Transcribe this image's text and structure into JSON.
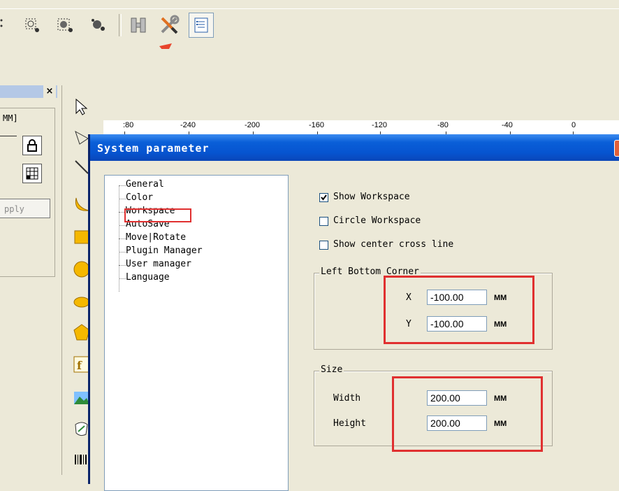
{
  "left_panel": {
    "unit_label": "MM]",
    "apply_label": "pply",
    "close_glyph": "×"
  },
  "ruler": {
    "ticks": [
      ":80",
      "-240",
      "-200",
      "-160",
      "-120",
      "-80",
      "-40",
      "0"
    ]
  },
  "dialog": {
    "title": "System parameter",
    "tree_items": [
      "General",
      "Color",
      "Workspace",
      "AutoSave",
      "Move|Rotate",
      "Plugin Manager",
      "User manager",
      "Language"
    ],
    "show_workspace": {
      "label": "Show Workspace",
      "checked": true
    },
    "circle_workspace": {
      "label": "Circle Workspace",
      "checked": false
    },
    "show_center_cross": {
      "label": "Show center cross line",
      "checked": false
    },
    "left_bottom_corner": {
      "title": "Left Bottom Corner",
      "x_label": "X",
      "x_value": "-100.00",
      "y_label": "Y",
      "y_value": "-100.00",
      "unit": "MM"
    },
    "size": {
      "title": "Size",
      "width_label": "Width",
      "width_value": "200.00",
      "height_label": "Height",
      "height_value": "200.00",
      "unit": "MM"
    }
  },
  "colors": {
    "highlight": "#e03030",
    "titlebar": "#0654d0",
    "arrow": "#e8452c"
  },
  "icons": [
    "select-points-icon",
    "nodes-icon",
    "nodes-filled-icon",
    "h-icon",
    "wrench-screwdriver-icon",
    "parameter-list-icon",
    "arrow-pointer-icon",
    "lock-icon",
    "grid-icon",
    "close-icon"
  ]
}
